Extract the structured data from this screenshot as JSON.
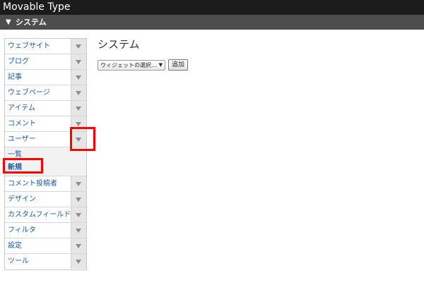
{
  "app": {
    "title": "Movable Type"
  },
  "scope": {
    "toggle_glyph": "▼",
    "name": "システム"
  },
  "menu": {
    "items_before": [
      {
        "id": "website",
        "label": "ウェブサイト"
      },
      {
        "id": "blog",
        "label": "ブログ"
      },
      {
        "id": "entry",
        "label": "記事"
      },
      {
        "id": "webpage",
        "label": "ウェブページ"
      },
      {
        "id": "asset",
        "label": "アイテム"
      },
      {
        "id": "comment",
        "label": "コメント"
      }
    ],
    "users": {
      "label": "ユーザー",
      "expanded": true
    },
    "users_submenu": [
      {
        "id": "list",
        "label": "一覧"
      },
      {
        "id": "new",
        "label": "新規"
      }
    ],
    "items_after": [
      {
        "id": "commenter",
        "label": "コメント投稿者"
      },
      {
        "id": "design",
        "label": "デザイン"
      },
      {
        "id": "custom-field",
        "label": "カスタムフィールド"
      },
      {
        "id": "filter",
        "label": "フィルタ"
      },
      {
        "id": "settings",
        "label": "設定"
      },
      {
        "id": "tools",
        "label": "ツール"
      }
    ]
  },
  "main": {
    "title": "システム",
    "widget_select": {
      "value": "ウィジェットの選択..."
    },
    "add_button_label": "追加"
  },
  "highlights": [
    "users-menu-toggle",
    "users-submenu-new"
  ],
  "colors": {
    "link": "#1a5ba8",
    "topbar": "#1c1c1c",
    "scopebar": "#4d4d4d",
    "highlight": "#ff0000"
  }
}
